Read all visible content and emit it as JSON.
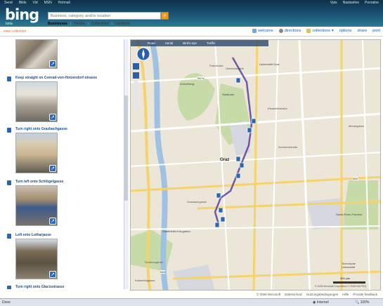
{
  "header": {
    "topnav": [
      "Send",
      "Bilds",
      "Vid",
      "MSN",
      "Hotmail"
    ],
    "topright": [
      "Vpis",
      "Nastavitve",
      "Povratne"
    ],
    "logo": "bing",
    "beta": "beta",
    "search_placeholder": "Business, category, and/or location",
    "tabs": [
      "Businesses",
      "People",
      "Collections",
      "Locations"
    ]
  },
  "subbar": {
    "view_collection": "view collection",
    "actions": [
      "welcome",
      "directions",
      "collections",
      "options",
      "share",
      "print"
    ]
  },
  "steps": [
    {
      "text": ""
    },
    {
      "text": "Keep straight on Conrad-von-Hotzendorf-strasse"
    },
    {
      "text": "Turn right onto Grazbachgasse"
    },
    {
      "text": "Turn left onto Schlögelgasse"
    },
    {
      "text": "Left onto Lotharjasse"
    },
    {
      "text": "Turn right onto Glacisstrasse"
    }
  ],
  "map": {
    "bar": [
      "Road",
      "Aerial",
      "Bird's eye",
      "Traffic"
    ],
    "labels": [
      "Parkstraße",
      "Heinrichstraße",
      "Universität Graz",
      "Schloßberg",
      "Stadtpark",
      "Elisabethstraße",
      "Graz",
      "Grazbachgasse",
      "Stadtfriedhof Augarten",
      "Sankt-Peter-Friedhof",
      "Technische Universität",
      "Schönaugürtel",
      "Kaiserfeldgasse",
      "Schubertstraße",
      "Merangasse",
      "B67a",
      "B67",
      "B65"
    ],
    "scale": "300 yds",
    "copyright": "© 2008 Microsoft Corporation © 2008 NAVTEQ"
  },
  "footer": [
    "© 2008 Microsoft",
    "Datenschutz",
    "Nutzungsbedingungen",
    "Hilfe",
    "Provide feedback"
  ],
  "status": {
    "left": "Done",
    "internet": "Internet",
    "zoom": "100%"
  },
  "colors": {
    "header": "#1c5878",
    "accent": "#e8731a",
    "route": "#5a3fa0",
    "pin": "#2b66b5"
  }
}
